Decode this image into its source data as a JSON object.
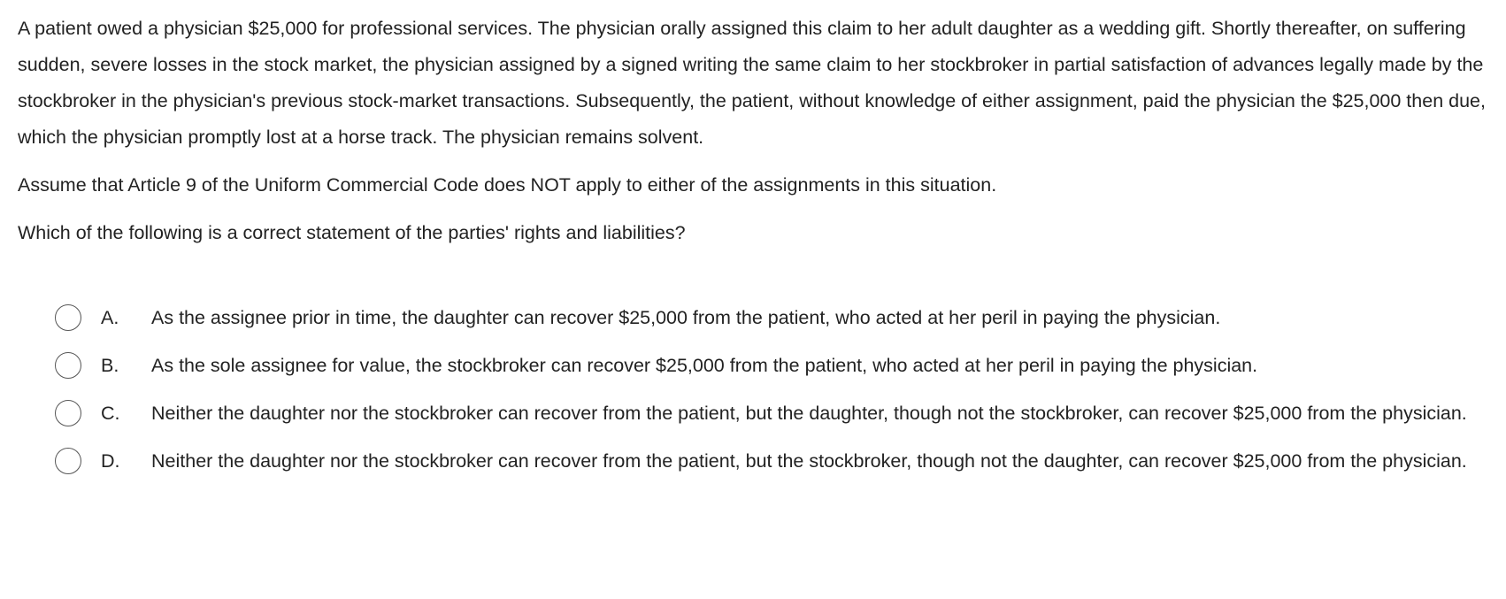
{
  "stem": {
    "paragraphs": [
      "A patient owed a physician $25,000 for professional services.  The physician orally assigned this claim to her adult daughter as a wedding gift.  Shortly thereafter, on suffering sudden, severe losses in the stock market, the physician assigned by a signed writing the same claim to her stockbroker in partial satisfaction of advances legally made by the stockbroker in the physician's previous stock-market transactions.  Subsequently, the patient, without knowledge of either assignment, paid the physician the $25,000 then due, which the physician promptly lost at a horse track.  The physician remains solvent.",
      "Assume that Article 9 of the Uniform Commercial Code does NOT apply to either of the assignments in this situation.",
      "Which of the following is a correct statement of the parties' rights and liabilities?"
    ]
  },
  "options": [
    {
      "letter": "A.",
      "text": "As the assignee prior in time, the daughter can recover $25,000 from the patient, who acted at her peril in paying the physician."
    },
    {
      "letter": "B.",
      "text": "As the sole assignee for value, the stockbroker can recover $25,000 from the patient, who acted at her peril in paying the physician."
    },
    {
      "letter": "C.",
      "text": "Neither the daughter nor the stockbroker can recover from the patient, but the daughter, though not the stockbroker, can recover $25,000 from the physician."
    },
    {
      "letter": "D.",
      "text": "Neither the daughter nor the stockbroker can recover from the patient, but the stockbroker, though not the daughter, can recover $25,000 from the physician."
    }
  ]
}
